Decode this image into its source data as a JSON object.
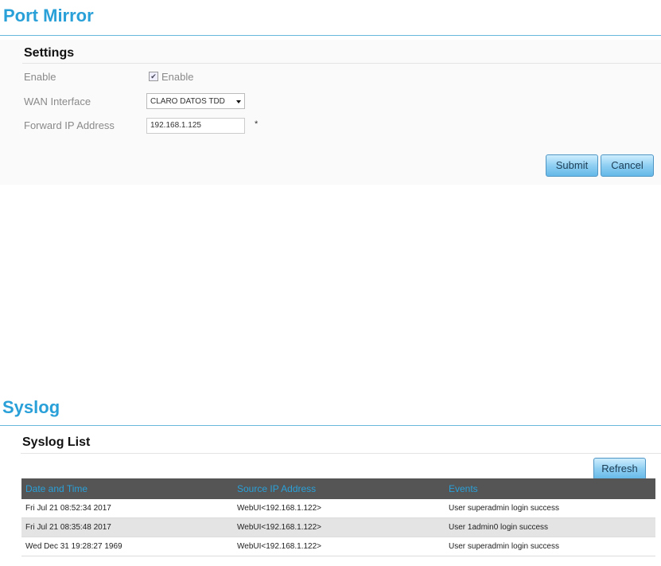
{
  "port_mirror": {
    "title": "Port Mirror",
    "section_title": "Settings",
    "enable": {
      "label": "Enable",
      "checkbox_label": "Enable",
      "checked": true
    },
    "wan_interface": {
      "label": "WAN Interface",
      "value": "CLARO DATOS TDD"
    },
    "forward_ip": {
      "label": "Forward IP Address",
      "value": "192.168.1.125",
      "required_mark": "*"
    },
    "submit_label": "Submit",
    "cancel_label": "Cancel"
  },
  "syslog": {
    "title": "Syslog",
    "section_title": "Syslog List",
    "refresh_label": "Refresh",
    "columns": [
      "Date and Time",
      "Source IP Address",
      "Events"
    ],
    "rows": [
      [
        "Fri Jul 21 08:52:34 2017",
        "WebUI<192.168.1.122>",
        "User superadmin login success"
      ],
      [
        "Fri Jul 21 08:35:48 2017",
        "WebUI<192.168.1.122>",
        "User 1admin0 login success"
      ],
      [
        "Wed Dec 31 19:28:27 1969",
        "WebUI<192.168.1.122>",
        "User superadmin login success"
      ]
    ]
  },
  "colors": {
    "accent": "#2aa0d8",
    "header_bg": "#555555",
    "button": "#8fcff2"
  }
}
